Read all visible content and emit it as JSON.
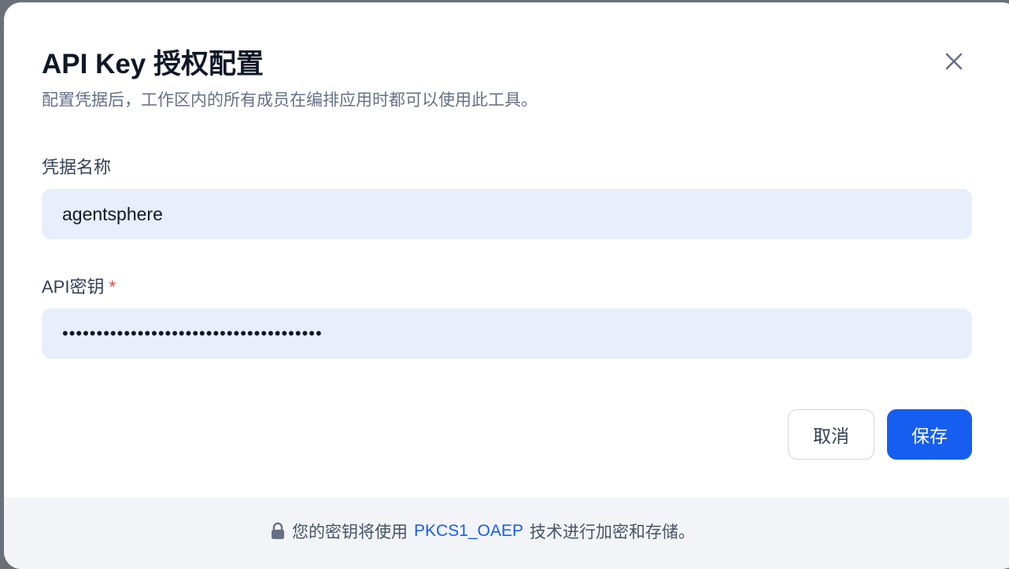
{
  "dialog": {
    "title": "API Key 授权配置",
    "subtitle": "配置凭据后，工作区内的所有成员在编排应用时都可以使用此工具。",
    "fields": [
      {
        "label": "凭据名称",
        "value": "agentsphere",
        "required": false
      },
      {
        "label": "API密钥",
        "value": "••••••••••••••••••••••••••••••••••••••",
        "required": true,
        "required_mark": "*"
      }
    ],
    "cancel_label": "取消",
    "save_label": "保存",
    "footer": {
      "prefix": "您的密钥将使用",
      "link": "PKCS1_OAEP",
      "suffix": "技术进行加密和存储。",
      "icon": "lock-icon"
    }
  },
  "colors": {
    "primary": "#155eef",
    "input_bg": "#e8eefb",
    "required": "#f04438"
  }
}
